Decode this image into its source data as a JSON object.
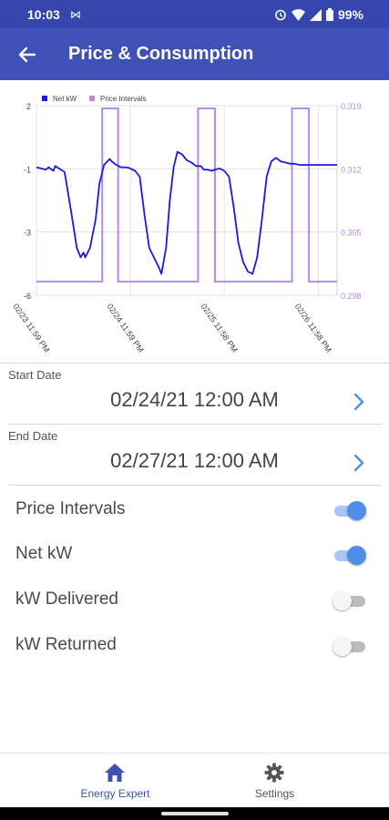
{
  "status_bar": {
    "time": "10:03",
    "battery": "99%"
  },
  "app_bar": {
    "title": "Price & Consumption",
    "back_icon": "arrow-back-icon"
  },
  "chart_data": {
    "type": "line",
    "legend": [
      "Net kW",
      "Price Intervals"
    ],
    "legend_placement": "top-left",
    "x_tick_labels": [
      "02/23 11:59 PM",
      "02/24 11:59 PM",
      "02/25 11:58 PM",
      "02/26 11:58 PM"
    ],
    "y_left_ticks": [
      "2",
      "-1",
      "-3",
      "-6"
    ],
    "y_left_range": [
      -6,
      2
    ],
    "y_right_ticks": [
      "0.319",
      "0.312",
      "0.305",
      "0.298"
    ],
    "y_right_range": [
      0.298,
      0.319
    ],
    "grid": true,
    "colors": {
      "net_kw": "#1a1ae6",
      "price_intervals": "#b58be8"
    },
    "series": [
      {
        "name": "Net kW",
        "axis": "left",
        "x": [
          0,
          0.05,
          0.1,
          0.13,
          0.18,
          0.2,
          0.3,
          0.37,
          0.43,
          0.47,
          0.5,
          0.52,
          0.57,
          0.63,
          0.67,
          0.72,
          0.78,
          0.8,
          0.85,
          0.9,
          0.95,
          0.98,
          1.05,
          1.1,
          1.15,
          1.2,
          1.25,
          1.3,
          1.33,
          1.38,
          1.42,
          1.46,
          1.5,
          1.55,
          1.6,
          1.65,
          1.7,
          1.75,
          1.78,
          1.82,
          1.87,
          1.9,
          1.95,
          2.0,
          2.05,
          2.1,
          2.15,
          2.2,
          2.25,
          2.3,
          2.35,
          2.4,
          2.45,
          2.5,
          2.55,
          2.6,
          2.65,
          2.7,
          2.75,
          2.8,
          2.85,
          2.9,
          2.95,
          3.0,
          3.05,
          3.1,
          3.15,
          3.2
        ],
        "y": [
          -0.6,
          -0.65,
          -0.7,
          -0.6,
          -0.75,
          -0.55,
          -0.8,
          -2.5,
          -4.0,
          -4.4,
          -4.2,
          -4.4,
          -4.0,
          -2.8,
          -1.3,
          -0.5,
          -0.25,
          -0.35,
          -0.5,
          -0.6,
          -0.6,
          -0.62,
          -0.75,
          -1.0,
          -2.6,
          -4.0,
          -4.4,
          -4.8,
          -5.1,
          -4.0,
          -2.0,
          -0.6,
          0.05,
          -0.05,
          -0.3,
          -0.4,
          -0.55,
          -0.55,
          -0.7,
          -0.7,
          -0.75,
          -0.7,
          -0.65,
          -0.75,
          -1.0,
          -2.3,
          -3.8,
          -4.6,
          -5.0,
          -5.1,
          -4.4,
          -2.8,
          -1.0,
          -0.35,
          -0.2,
          -0.35,
          -0.4,
          -0.45,
          -0.45,
          -0.5,
          -0.5,
          -0.5,
          -0.5,
          -0.5,
          -0.5,
          -0.5,
          -0.5,
          -0.5
        ]
      },
      {
        "name": "Price Intervals",
        "axis": "right",
        "x": [
          0,
          0.7,
          0.7,
          0.87,
          0.87,
          1.72,
          1.72,
          1.9,
          1.9,
          2.72,
          2.72,
          2.9,
          2.9,
          3.2
        ],
        "y": [
          0.2995,
          0.2995,
          0.3187,
          0.3187,
          0.2995,
          0.2995,
          0.3187,
          0.3187,
          0.2995,
          0.2995,
          0.3187,
          0.3187,
          0.2995,
          0.2995
        ]
      }
    ],
    "x_range": [
      0,
      3.2
    ],
    "x_tick_positions": [
      0,
      1,
      2,
      3
    ]
  },
  "form": {
    "start": {
      "label": "Start Date",
      "value": "02/24/21 12:00 AM"
    },
    "end": {
      "label": "End Date",
      "value": "02/27/21 12:00 AM"
    }
  },
  "toggles": [
    {
      "label": "Price Intervals",
      "on": true
    },
    {
      "label": "Net kW",
      "on": true
    },
    {
      "label": "kW Delivered",
      "on": false
    },
    {
      "label": "kW Returned",
      "on": false
    }
  ],
  "bottom_nav": [
    {
      "label": "Energy Expert",
      "icon": "home-icon",
      "active": true,
      "color": "#3f51b5"
    },
    {
      "label": "Settings",
      "icon": "gear-icon",
      "active": false,
      "color": "#555555"
    }
  ]
}
